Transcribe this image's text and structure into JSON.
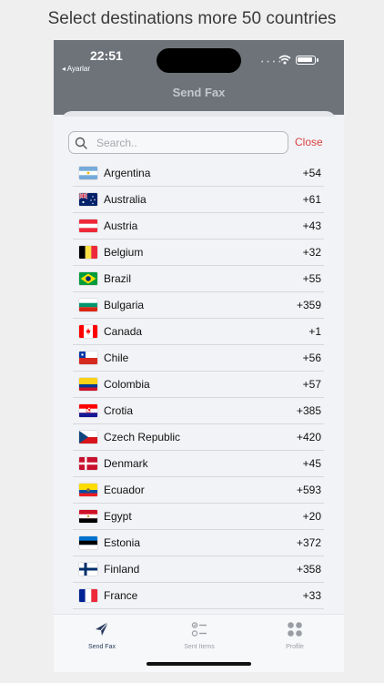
{
  "caption": "Select destinations more 50 countries",
  "status": {
    "time": "22:51",
    "back_label": "◂ Ayarlar",
    "signal_dots": "• • • •"
  },
  "nav": {
    "title": "Send Fax"
  },
  "search": {
    "placeholder": "Search..",
    "value": "",
    "close_label": "Close"
  },
  "countries": [
    {
      "name": "Argentina",
      "code": "+54",
      "flag": "argentina-flag"
    },
    {
      "name": "Australia",
      "code": "+61",
      "flag": "australia-flag"
    },
    {
      "name": "Austria",
      "code": "+43",
      "flag": "austria-flag"
    },
    {
      "name": "Belgium",
      "code": "+32",
      "flag": "belgium-flag"
    },
    {
      "name": "Brazil",
      "code": "+55",
      "flag": "brazil-flag"
    },
    {
      "name": "Bulgaria",
      "code": "+359",
      "flag": "bulgaria-flag"
    },
    {
      "name": "Canada",
      "code": "+1",
      "flag": "canada-flag"
    },
    {
      "name": "Chile",
      "code": "+56",
      "flag": "chile-flag"
    },
    {
      "name": "Colombia",
      "code": "+57",
      "flag": "colombia-flag"
    },
    {
      "name": "Crotia",
      "code": "+385",
      "flag": "croatia-flag"
    },
    {
      "name": "Czech Republic",
      "code": "+420",
      "flag": "czech-republic-flag"
    },
    {
      "name": "Denmark",
      "code": "+45",
      "flag": "denmark-flag"
    },
    {
      "name": "Ecuador",
      "code": "+593",
      "flag": "ecuador-flag"
    },
    {
      "name": "Egypt",
      "code": "+20",
      "flag": "egypt-flag"
    },
    {
      "name": "Estonia",
      "code": "+372",
      "flag": "estonia-flag"
    },
    {
      "name": "Finland",
      "code": "+358",
      "flag": "finland-flag"
    },
    {
      "name": "France",
      "code": "+33",
      "flag": "france-flag"
    }
  ],
  "tabs": [
    {
      "label": "Send Fax",
      "icon": "paper-plane-icon",
      "active": true
    },
    {
      "label": "Sent Items",
      "icon": "checklist-icon",
      "active": false
    },
    {
      "label": "Profile",
      "icon": "grid-icon",
      "active": false
    }
  ],
  "colors": {
    "accent": "#2a3a5e",
    "close": "#d94040",
    "nav_bar": "#6e737a"
  }
}
